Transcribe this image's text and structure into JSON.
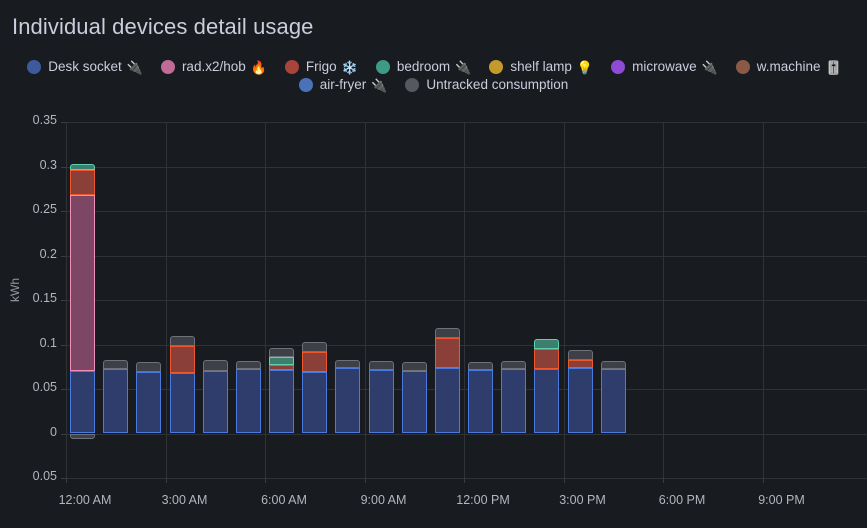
{
  "panel": {
    "title": "Individual devices detail usage",
    "background": "#181b1f",
    "text_color": "#ccccdc",
    "grid_color": "#2f3237"
  },
  "legend": {
    "position": "top-center",
    "rows": [
      [
        {
          "label": "Desk socket",
          "emoji": "🔌",
          "color": "#3d5a9e",
          "icon": "plug-icon"
        },
        {
          "label": "rad.x2/hob",
          "emoji": "🔥",
          "color": "#c06b97",
          "icon": "fire-icon"
        },
        {
          "label": "Frigo",
          "emoji": "❄️",
          "color": "#a9443a",
          "icon": "snowflake-icon"
        },
        {
          "label": "bedroom",
          "emoji": "🔌",
          "color": "#3e9a84",
          "icon": "plug-icon"
        },
        {
          "label": "shelf lamp",
          "emoji": "💡",
          "color": "#c49a2c",
          "icon": "bulb-icon"
        },
        {
          "label": "microwave",
          "emoji": "🔌",
          "color": "#8f4ad6",
          "icon": "plug-icon"
        },
        {
          "label": "w.machine",
          "emoji": "🎚️",
          "color": "#8a5a46",
          "icon": "washer-icon"
        }
      ],
      [
        {
          "label": "air-fryer",
          "emoji": "🔌",
          "color": "#4a72b8",
          "icon": "plug-icon"
        },
        {
          "label": "Untracked consumption",
          "emoji": "",
          "color": "#55585e",
          "icon": "untracked-icon"
        }
      ]
    ]
  },
  "chart_data": {
    "type": "bar",
    "stacked": true,
    "title": "Individual devices detail usage",
    "xlabel": "",
    "ylabel": "kWh",
    "ylim": [
      -0.05,
      0.35
    ],
    "yticks": [
      "0.35",
      "0.3",
      "0.25",
      "0.2",
      "0.15",
      "0.1",
      "0.05",
      "0",
      "0.05"
    ],
    "ytick_values": [
      0.35,
      0.3,
      0.25,
      0.2,
      0.15,
      0.1,
      0.05,
      0,
      -0.05
    ],
    "grid": true,
    "legend_position": "top",
    "xticks": [
      "12:00 AM",
      "3:00 AM",
      "6:00 AM",
      "9:00 AM",
      "12:00 PM",
      "3:00 PM",
      "6:00 PM",
      "9:00 PM"
    ],
    "categories": [
      "12:00 AM",
      "1:00 AM",
      "2:00 AM",
      "3:00 AM",
      "4:00 AM",
      "5:00 AM",
      "6:00 AM",
      "7:00 AM",
      "8:00 AM",
      "9:00 AM",
      "10:00 AM",
      "11:00 AM",
      "12:00 PM",
      "1:00 PM",
      "2:00 PM",
      "3:00 PM",
      "4:00 PM"
    ],
    "series": [
      {
        "name": "Desk socket",
        "color": "#2e3d6b",
        "border": "#4a7ae0",
        "values": [
          0.07,
          0.072,
          0.069,
          0.068,
          0.07,
          0.072,
          0.071,
          0.069,
          0.074,
          0.071,
          0.07,
          0.074,
          0.071,
          0.072,
          0.072,
          0.074,
          0.072
        ]
      },
      {
        "name": "rad.x2/hob",
        "color": "#7d4664",
        "border": "#f090b8",
        "values": [
          0.198,
          0,
          0,
          0,
          0,
          0,
          0,
          0,
          0,
          0,
          0,
          0,
          0,
          0,
          0,
          0,
          0
        ]
      },
      {
        "name": "Frigo",
        "color": "#8a4038",
        "border": "#f0572c",
        "values": [
          0.028,
          0,
          0,
          0.03,
          0,
          0,
          0.006,
          0.023,
          0,
          0,
          0,
          0.033,
          0,
          0,
          0.023,
          0.009,
          0
        ]
      },
      {
        "name": "bedroom",
        "color": "#3d7f6e",
        "border": "#5ecfb0",
        "values": [
          0.007,
          0,
          0,
          0,
          0,
          0,
          0.009,
          0,
          0,
          0,
          0,
          0,
          0,
          0,
          0.011,
          0,
          0
        ]
      },
      {
        "name": "shelf lamp",
        "color": "#7d6420",
        "border": "#e8b939",
        "values": [
          0,
          0,
          0,
          0,
          0,
          0,
          0,
          0,
          0,
          0,
          0,
          0,
          0,
          0,
          0,
          0,
          0
        ]
      },
      {
        "name": "microwave",
        "color": "#5c3282",
        "border": "#b27ae8",
        "values": [
          0,
          0,
          0,
          0,
          0,
          0,
          0,
          0,
          0,
          0,
          0,
          0,
          0,
          0,
          0,
          0,
          0
        ]
      },
      {
        "name": "w.machine",
        "color": "#5c3e30",
        "border": "#a8765a",
        "values": [
          0,
          0,
          0,
          0,
          0,
          0,
          0,
          0,
          0,
          0,
          0,
          0,
          0,
          0,
          0,
          0,
          0
        ]
      },
      {
        "name": "air-fryer",
        "color": "#30446f",
        "border": "#5b84cf",
        "values": [
          0,
          0,
          0,
          0,
          0,
          0,
          0,
          0,
          0,
          0,
          0,
          0,
          0,
          0,
          0,
          0,
          0
        ]
      },
      {
        "name": "Untracked consumption",
        "color": "#3d4046",
        "border": "#6e7178",
        "values": [
          -0.006,
          0.011,
          0.011,
          0.011,
          0.013,
          0.01,
          0.01,
          0.011,
          0.009,
          0.01,
          0.01,
          0.011,
          0.009,
          0.01,
          0,
          0.011,
          0.009
        ]
      }
    ]
  }
}
